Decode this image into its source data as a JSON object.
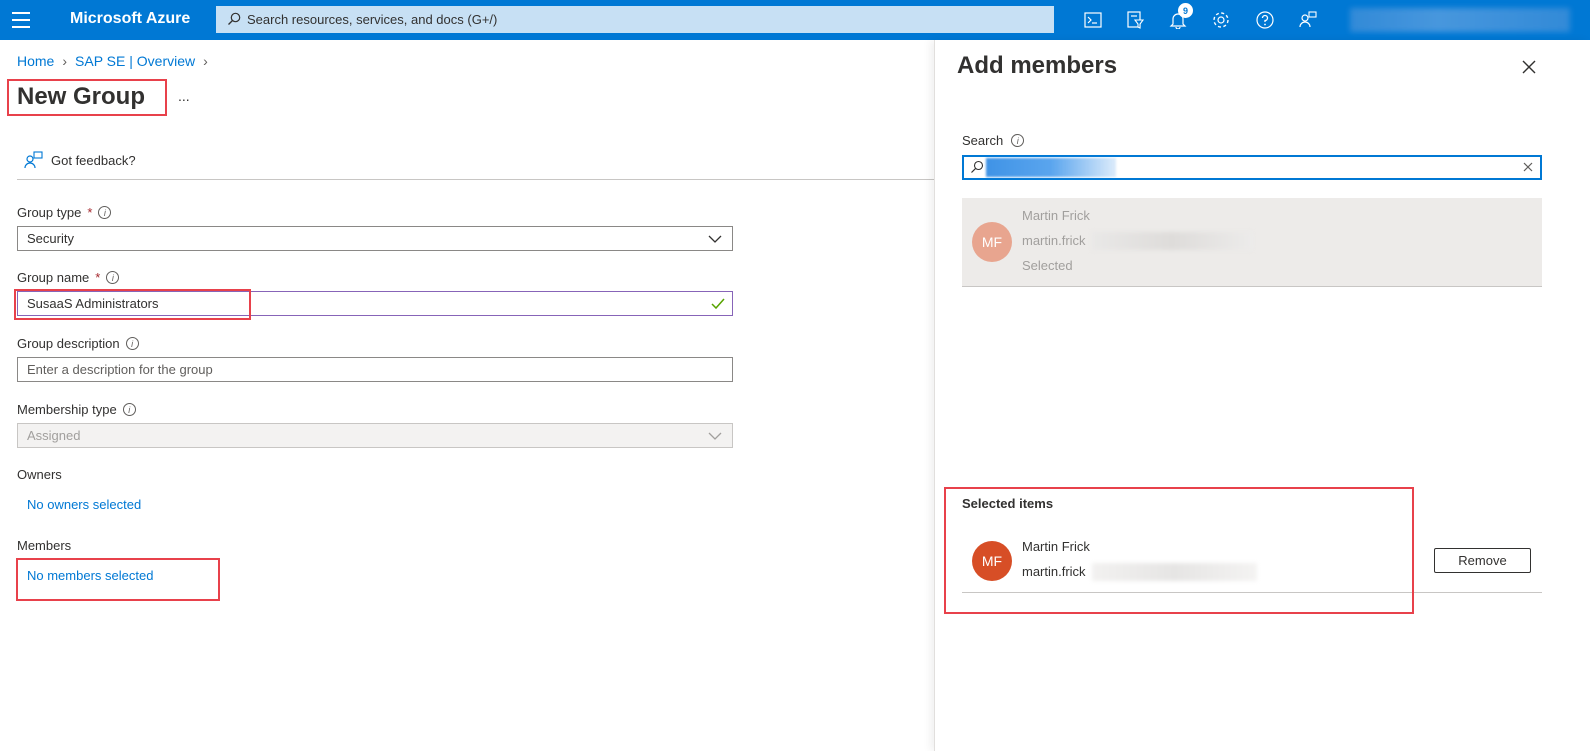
{
  "topbar": {
    "brand": "Microsoft Azure",
    "search_placeholder": "Search resources, services, and docs (G+/)",
    "notification_count": "9",
    "icons": [
      "cloud-shell-icon",
      "directory-filter-icon",
      "bell-icon",
      "gear-icon",
      "help-icon",
      "feedback-icon"
    ]
  },
  "breadcrumb": {
    "items": [
      "Home",
      "SAP SE | Overview"
    ]
  },
  "page": {
    "title": "New Group",
    "more": "...",
    "feedback": "Got feedback?"
  },
  "form": {
    "group_type": {
      "label": "Group type",
      "required": "*",
      "value": "Security"
    },
    "group_name": {
      "label": "Group name",
      "required": "*",
      "value": "SusaaS Administrators"
    },
    "group_description": {
      "label": "Group description",
      "placeholder": "Enter a description for the group"
    },
    "membership_type": {
      "label": "Membership type",
      "value": "Assigned"
    },
    "owners": {
      "label": "Owners",
      "link": "No owners selected"
    },
    "members": {
      "label": "Members",
      "link": "No members selected"
    }
  },
  "panel": {
    "title": "Add members",
    "search_label": "Search",
    "result": {
      "initials": "MF",
      "name": "Martin Frick",
      "email": "martin.frick",
      "status": "Selected"
    },
    "selected_title": "Selected items",
    "selected": {
      "initials": "MF",
      "name": "Martin Frick",
      "email": "martin.frick",
      "remove_label": "Remove"
    }
  },
  "colors": {
    "accent": "#0078d4",
    "highlight": "#e8414b",
    "avatar_active": "#d74e26",
    "avatar_muted": "#e8a58f"
  }
}
